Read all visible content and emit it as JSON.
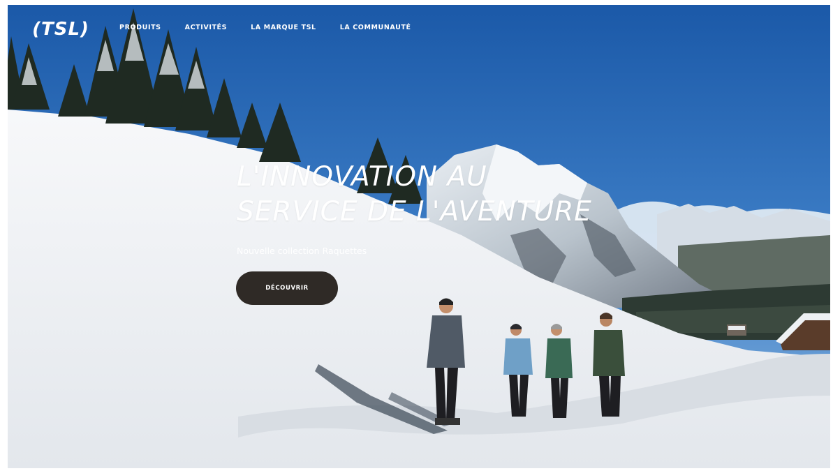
{
  "header": {
    "logo_text": "(TSL)",
    "nav": [
      {
        "label": "PRODUITS"
      },
      {
        "label": "ACTIVITÉS"
      },
      {
        "label": "LA MARQUE TSL"
      },
      {
        "label": "LA COMMUNAUTÉ"
      }
    ]
  },
  "hero": {
    "title_line1": "L'INNOVATION AU",
    "title_line2": "SERVICE DE L'AVENTURE",
    "subtitle": "Nouvelle collection Raquettes",
    "cta_label": "DÉCOUVRIR",
    "background_description_icon": "snowy-mountain-landscape-photo"
  },
  "colors": {
    "sky_top": "#1d5eae",
    "sky_bottom": "#6fa3d8",
    "snow": "#f1f3f6",
    "cta_bg": "#2f2a26"
  }
}
